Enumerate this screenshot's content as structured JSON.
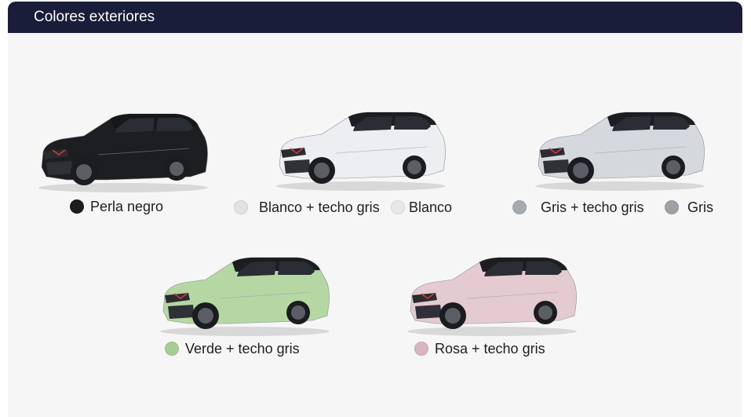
{
  "header": {
    "title": "Colores exteriores"
  },
  "colors": {
    "perla_negro": {
      "label": "Perla negro",
      "hex": "#1c1c1e"
    },
    "blanco_techo_gris": {
      "label": "Blanco + techo gris",
      "hex": "#dfe2e6"
    },
    "blanco": {
      "label": "Blanco",
      "hex": "#e6e8ec"
    },
    "gris_techo_gris": {
      "label": "Gris + techo gris",
      "hex": "#a7abb1"
    },
    "gris": {
      "label": "Gris",
      "hex": "#9ea2a8"
    },
    "verde_techo_gris": {
      "label": "Verde + techo gris",
      "hex": "#a8cc98"
    },
    "rosa_techo_gris": {
      "label": "Rosa + techo gris",
      "hex": "#d9b5bf"
    }
  },
  "cars": [
    {
      "icon": "black-suv-image",
      "body": "#1d1e22",
      "roof": "#16171a"
    },
    {
      "icon": "white-suv-image",
      "body": "#eceef2",
      "roof": "#1c1d21"
    },
    {
      "icon": "grey-suv-image",
      "body": "#d5d9de",
      "roof": "#1c1d21"
    },
    {
      "icon": "green-suv-image",
      "body": "#b5d7a4",
      "roof": "#1c1d21"
    },
    {
      "icon": "pink-suv-image",
      "body": "#e4cbd1",
      "roof": "#1c1d21"
    }
  ]
}
